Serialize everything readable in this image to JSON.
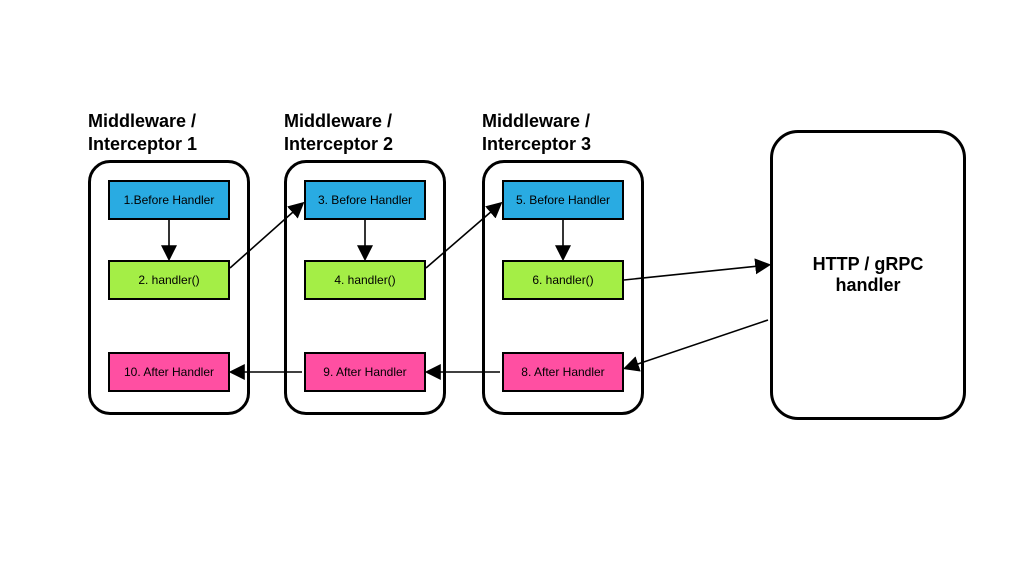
{
  "chart_data": {
    "type": "diagram",
    "description": "Middleware / interceptor chain around an HTTP/gRPC handler showing the numbered before/handler/after execution order across three nested middlewares.",
    "middlewares": [
      {
        "title": "Middleware /\nInterceptor 1",
        "before": "1.Before Handler",
        "handler": "2. handler()",
        "after": "10. After Handler"
      },
      {
        "title": "Middleware /\nInterceptor 2",
        "before": "3. Before Handler",
        "handler": "4. handler()",
        "after": "9. After Handler"
      },
      {
        "title": "Middleware /\nInterceptor 3",
        "before": "5. Before Handler",
        "handler": "6. handler()",
        "after": "8. After Handler"
      }
    ],
    "final": "HTTP / gRPC handler",
    "flow": [
      "mw1.before -> mw1.handler",
      "mw1.handler -> mw2.before",
      "mw2.before -> mw2.handler",
      "mw2.handler -> mw3.before",
      "mw3.before -> mw3.handler",
      "mw3.handler -> final",
      "final -> mw3.after",
      "mw3.after -> mw2.after",
      "mw2.after -> mw1.after"
    ]
  }
}
